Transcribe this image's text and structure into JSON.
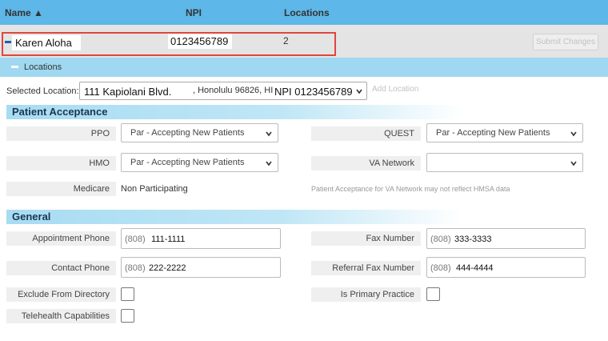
{
  "header": {
    "name_label": "Name ▲",
    "npi_label": "NPI",
    "locations_label": "Locations"
  },
  "provider": {
    "name": "Karen Aloha",
    "npi": "0123456789",
    "locations_count": "2",
    "submit_label": "Submit Changes"
  },
  "locations_section": {
    "label": "Locations",
    "selected_location_label": "Selected Location:",
    "address_line": "111 Kapiolani Blvd.",
    "city_line": ", Honolulu 96826, HI",
    "npi_text": "NPI 0123456789",
    "add_location_label": "Add Location"
  },
  "patient_acceptance": {
    "title": "Patient Acceptance",
    "ppo_label": "PPO",
    "ppo_value": "Par - Accepting New Patients",
    "quest_label": "QUEST",
    "quest_value": "Par - Accepting New Patients",
    "hmo_label": "HMO",
    "hmo_value": "Par - Accepting New Patients",
    "va_label": "VA Network",
    "va_value": "",
    "medicare_label": "Medicare",
    "medicare_value": "Non Participating",
    "va_note": "Patient Acceptance for VA Network may not reflect HMSA data"
  },
  "general": {
    "title": "General",
    "appointment_phone_label": "Appointment Phone",
    "appointment_phone_area": "(808)",
    "appointment_phone_number": "111-1111",
    "fax_label": "Fax Number",
    "fax_area": "(808)",
    "fax_number": "333-3333",
    "contact_phone_label": "Contact Phone",
    "contact_phone_area": "(808)",
    "contact_phone_number": "222-2222",
    "referral_fax_label": "Referral Fax Number",
    "referral_fax_area": "(808)",
    "referral_fax_number": "444-4444",
    "exclude_label": "Exclude From Directory",
    "primary_label": "Is Primary Practice",
    "telehealth_label": "Telehealth Capabilities"
  },
  "colors": {
    "header_bg": "#5db7e8",
    "locations_bar_bg": "#9fd8f0",
    "highlight_border": "#e0453f",
    "section_title": "#1a3550"
  }
}
